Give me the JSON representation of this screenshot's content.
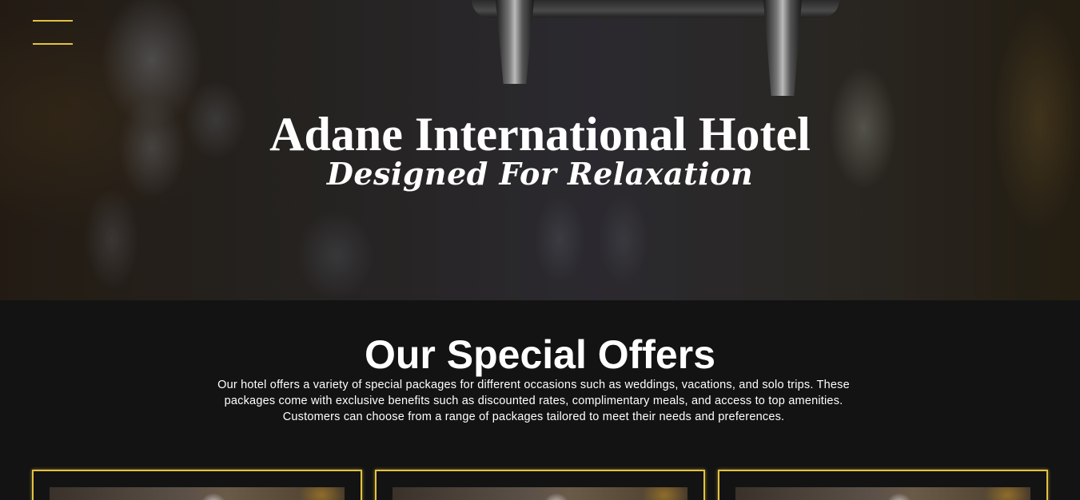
{
  "hero": {
    "title": "Adane International Hotel",
    "subtitle": "Designed For Relaxation"
  },
  "menu": {
    "icon": "hamburger-menu-icon",
    "color": "#e3c240"
  },
  "offers": {
    "title": "Our Special Offers",
    "description": "Our hotel offers a variety of special packages for different occasions such as weddings, vacations, and solo trips. These packages come with exclusive benefits such as discounted rates, complimentary meals, and access to top amenities. Customers can choose from a range of packages tailored to meet their needs and preferences.",
    "accent_color": "#e3c240"
  }
}
